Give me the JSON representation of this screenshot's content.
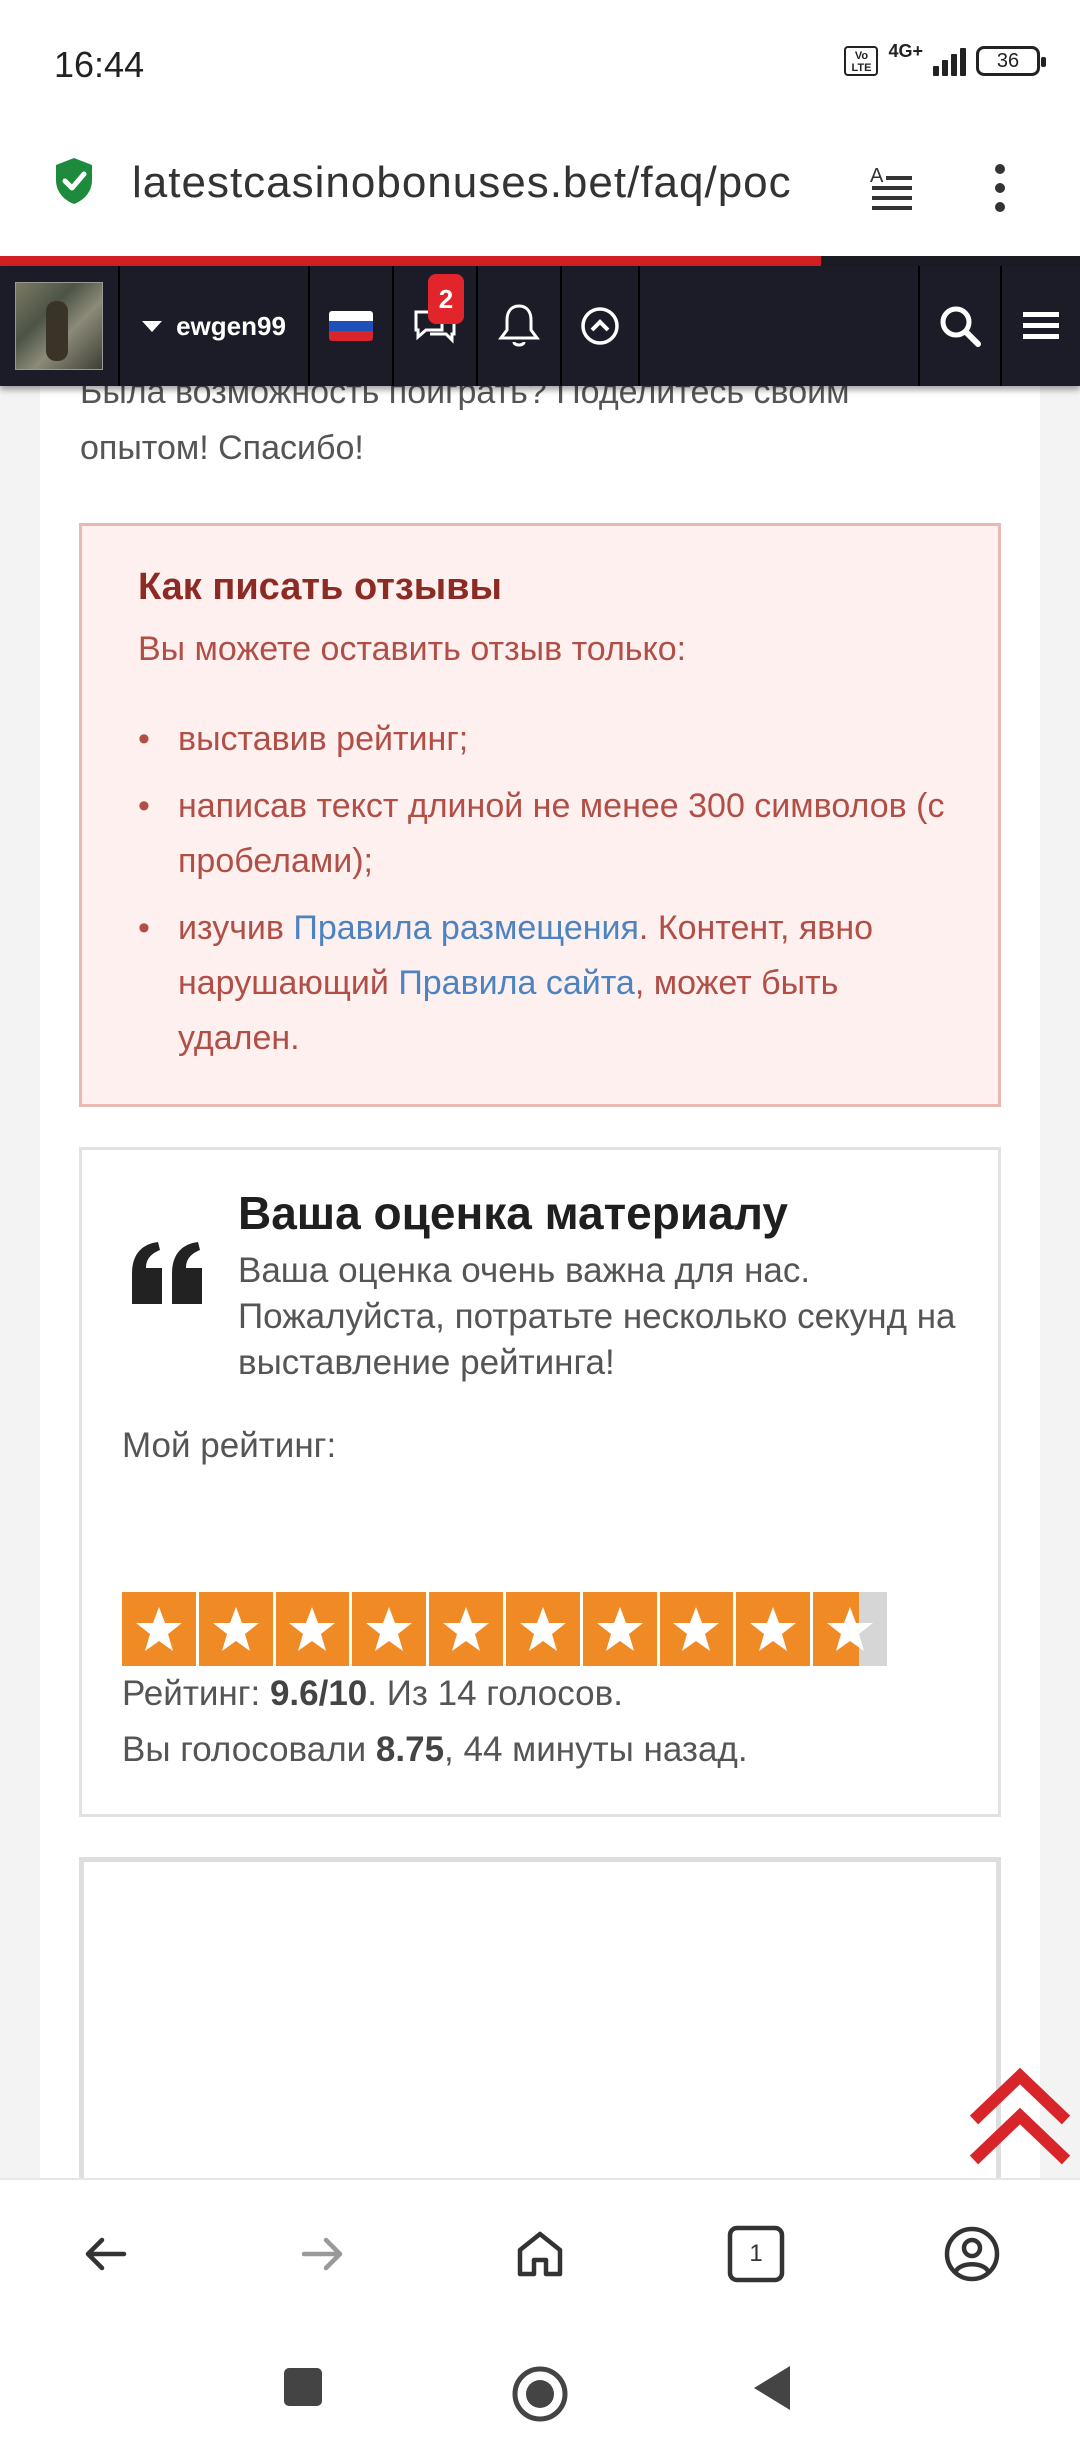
{
  "status_bar": {
    "time": "16:44",
    "network_type": "4G+",
    "volte_label": "Vo LTE",
    "battery_level": "36"
  },
  "browser": {
    "url": "latestcasinobonuses.bet/faq/poc",
    "page_load_progress": 0.76
  },
  "site_header": {
    "username": "ewgen99",
    "notification_count": "2",
    "flag_colors": [
      "#ffffff",
      "#1f4fb8",
      "#d8242a"
    ]
  },
  "article": {
    "intro_text": "Была возможность поиграть? Поделитесь своим опытом! Спасибо!"
  },
  "howto": {
    "title": "Как писать отзывы",
    "subtitle": "Вы можете оставить отзыв только:",
    "item1": "выставив рейтинг;",
    "item2": "написав текст длиной не менее 300 символов (с пробелами);",
    "item3_prefix": "изучив ",
    "item3_link1": "Правила размещения",
    "item3_middle": ". Контент, явно нарушающий ",
    "item3_link2": "Правила сайта",
    "item3_suffix": ", может быть удален."
  },
  "rating": {
    "title": "Ваша оценка материалу",
    "description": "Ваша оценка очень важна для нас. Пожалуйста, потратьте несколько секунд на выставление рейтинга!",
    "my_rating_label": "Мой рейтинг:",
    "star_count": 10,
    "score": 9.6,
    "summary_prefix": "Рейтинг: ",
    "summary_score": "9.6/10",
    "summary_suffix": ". Из 14 голосов.",
    "voted_prefix": "Вы голосовали ",
    "voted_value": "8.75",
    "voted_suffix": ", 44 минуты назад."
  },
  "bottom_bar": {
    "tabs_count": "1"
  },
  "colors": {
    "accent_red": "#d02024",
    "header_dark": "#1b1c27",
    "star_orange": "#f08a24",
    "link_blue": "#4c83c0",
    "alert_text": "#b14f47"
  }
}
